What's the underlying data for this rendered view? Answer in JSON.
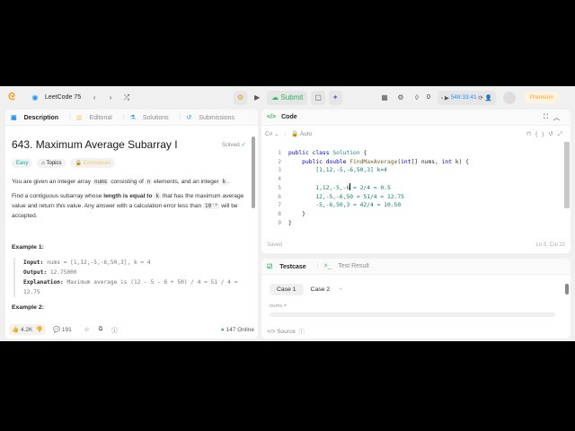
{
  "nav": {
    "study_plan": "LeetCode 75",
    "submit": "Submit",
    "streak": "0",
    "timer": "548:33:41",
    "premium": "Premium"
  },
  "left": {
    "tabs": [
      "Description",
      "Editorial",
      "Solutions",
      "Submissions"
    ],
    "title": "643. Maximum Average Subarray I",
    "status": "Solved",
    "tags": [
      "Easy",
      "Topics",
      "Companies"
    ],
    "p1": [
      "You are given an integer array ",
      "nums",
      " consisting of ",
      "n",
      " elements, and an integer ",
      "k",
      "."
    ],
    "p2": [
      "Find a contiguous subarray whose ",
      "length is equal to",
      " ",
      "k",
      " that has the maximum average value and return ",
      "this value",
      ". Any answer with a calculation error less than ",
      "10⁻⁵",
      " will be accepted."
    ],
    "example_title": "Example 1:",
    "ex": {
      "input_label": "Input:",
      "input": "nums = [1,12,-5,-6,50,3], k = 4",
      "output_label": "Output:",
      "output": "12.75000",
      "expl_label": "Explanation:",
      "expl": "Maximum average is (12 - 5 - 6 + 50) / 4 = 51 / 4 = 12.75"
    },
    "example2": "Example 2:",
    "footer": {
      "likes": "4.2K",
      "comments": "191",
      "online": "147 Online"
    }
  },
  "code": {
    "title": "Code",
    "lang": "C#",
    "mode": "Auto",
    "saved": "Saved",
    "cursor": "Ln 5, Col 22",
    "lines": [
      "public class Solution {",
      "    public double FindMaxAverage(int[] nums, int k) {",
      "        [1,12,-5,-6,50,3] k=4",
      "",
      "        1,12,-5,-6 = 2/4 = 0.5",
      "        12,-5,-6,50 = 51/4 = 12.75",
      "        -5,-6,50,3 = 42/4 = 10.50",
      "    }",
      "}"
    ]
  },
  "test": {
    "tabs": [
      "Testcase",
      "Test Result"
    ],
    "cases": [
      "Case 1",
      "Case 2"
    ],
    "add": "+",
    "var": "nums =",
    "source": "Source"
  },
  "colors": {
    "green": "#2db55d",
    "accent": "#1a90ff",
    "premium": "#f5a623",
    "easy": "#00af9b"
  }
}
